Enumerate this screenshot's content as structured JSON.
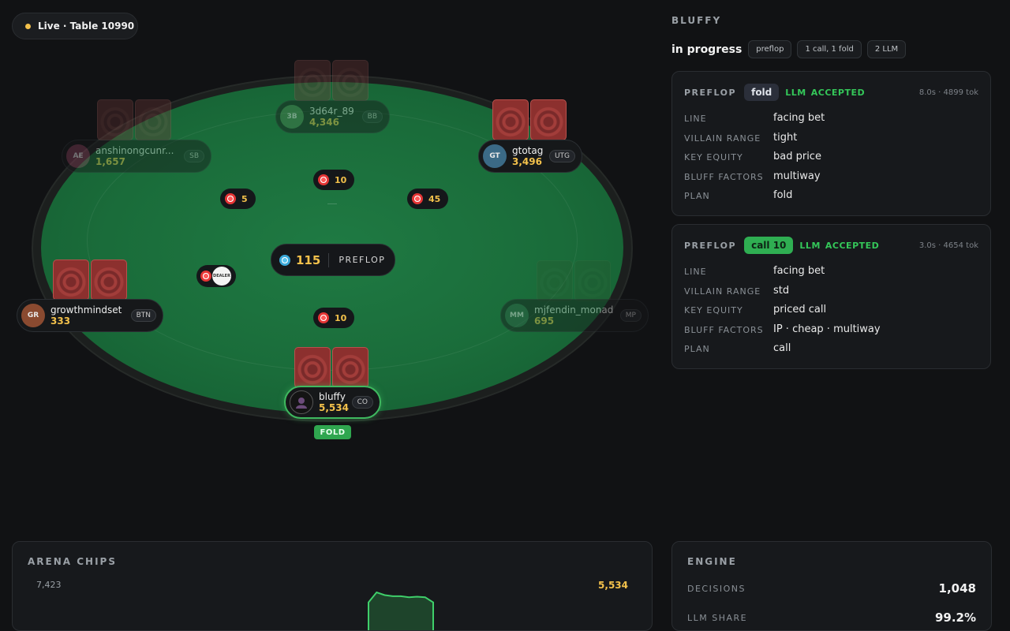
{
  "header": {
    "live_label": "Live · Table 10990"
  },
  "table": {
    "pot": {
      "amount": "115",
      "stage": "PREFLOP"
    },
    "dealer_label": "DEALER",
    "bets": {
      "top": "10",
      "upper_left": "5",
      "upper_right": "45",
      "bottom": "10"
    },
    "seats": [
      {
        "initials": "3B",
        "name": "3d64r_89",
        "stack": "4,346",
        "position": "BB",
        "color": "#4a7c4f"
      },
      {
        "initials": "AE",
        "name": "anshinongcunr...",
        "stack": "1,657",
        "position": "SB",
        "color": "#7a3a52"
      },
      {
        "initials": "GT",
        "name": "gtotag",
        "stack": "3,496",
        "position": "UTG",
        "color": "#3b6a86"
      },
      {
        "initials": "GR",
        "name": "growthmindset",
        "stack": "333",
        "position": "BTN",
        "color": "#8a4a30"
      },
      {
        "initials": "MM",
        "name": "mjfendin_monad",
        "stack": "695",
        "position": "MP",
        "color": "#2f5a44"
      },
      {
        "initials": "",
        "name": "bluffy",
        "stack": "5,534",
        "position": "CO",
        "color": "#141414"
      }
    ],
    "hero_action": "FOLD"
  },
  "panel": {
    "title": "BLUFFY",
    "status": "in progress",
    "tags": [
      "preflop",
      "1 call, 1 fold",
      "2 LLM"
    ],
    "decisions": [
      {
        "street": "PREFLOP",
        "action": "fold",
        "source": "LLM",
        "status": "ACCEPTED",
        "meta": "8.0s · 4899 tok",
        "rows": [
          {
            "label": "LINE",
            "value": "facing bet"
          },
          {
            "label": "VILLAIN RANGE",
            "value": "tight"
          },
          {
            "label": "KEY EQUITY",
            "value": "bad price"
          },
          {
            "label": "BLUFF FACTORS",
            "value": "multiway"
          },
          {
            "label": "PLAN",
            "value": "fold"
          }
        ]
      },
      {
        "street": "PREFLOP",
        "action": "call 10",
        "source": "LLM",
        "status": "ACCEPTED",
        "meta": "3.0s · 4654 tok",
        "rows": [
          {
            "label": "LINE",
            "value": "facing bet"
          },
          {
            "label": "VILLAIN RANGE",
            "value": "std"
          },
          {
            "label": "KEY EQUITY",
            "value": "priced call"
          },
          {
            "label": "BLUFF FACTORS",
            "value": "IP · cheap · multiway"
          },
          {
            "label": "PLAN",
            "value": "call"
          }
        ]
      }
    ]
  },
  "arena_chips": {
    "title": "ARENA CHIPS",
    "max_label": "7,423",
    "current_label": "5,534"
  },
  "chart_data": {
    "type": "area",
    "series": [
      {
        "values": [
          5534,
          7423,
          6900,
          6700,
          6700,
          6500,
          6600,
          6500,
          5534
        ]
      }
    ],
    "ylim": [
      0,
      7423
    ]
  },
  "engine": {
    "title": "ENGINE",
    "rows": [
      {
        "label": "DECISIONS",
        "value": "1,048"
      },
      {
        "label": "LLM SHARE",
        "value": "99.2%"
      }
    ]
  },
  "colors": {
    "accent_green": "#34c759",
    "gold": "#f3c14b",
    "felt": "#1a6c3a"
  }
}
